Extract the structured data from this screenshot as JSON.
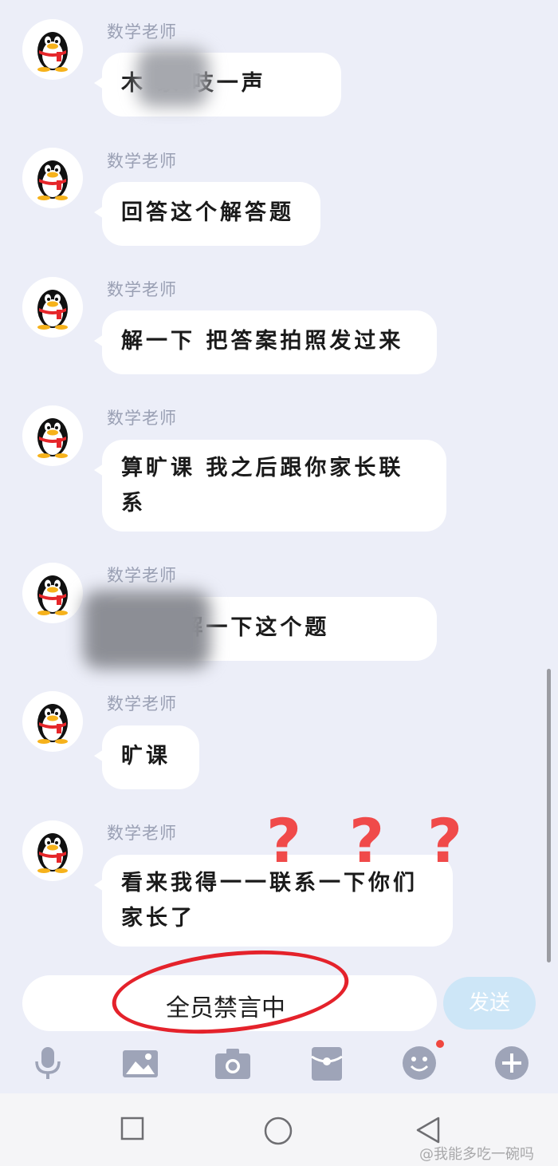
{
  "chat": {
    "messages": [
      {
        "sender": "数学老师",
        "text": "木    家  吱一声"
      },
      {
        "sender": "数学老师",
        "text": "回答这个解答题"
      },
      {
        "sender": "数学老师",
        "text": "解一下 把答案拍照发过来"
      },
      {
        "sender": "数学老师",
        "text": "算旷课  我之后跟你家长联系"
      },
      {
        "sender": "数学老师",
        "text": "     法 你解一下这个题"
      },
      {
        "sender": "数学老师",
        "text": "旷课"
      },
      {
        "sender": "数学老师",
        "text": "看来我得一一联系一下你们家长了"
      }
    ],
    "annotation_marks": [
      "?",
      "?",
      "?"
    ]
  },
  "input": {
    "status_text": "全员禁言中",
    "send_label": "发送"
  },
  "toolbar": {
    "icons": [
      "microphone-icon",
      "image-icon",
      "camera-icon",
      "red-packet-icon",
      "emoji-icon",
      "plus-icon"
    ]
  },
  "navbar": {
    "icons": [
      "recent-apps-icon",
      "home-icon",
      "back-icon"
    ]
  },
  "watermark": "@我能多吃一碗吗",
  "colors": {
    "background": "#eceef8",
    "bubble": "#ffffff",
    "send_button": "#cde6f7",
    "annotation": "#e4222b"
  }
}
